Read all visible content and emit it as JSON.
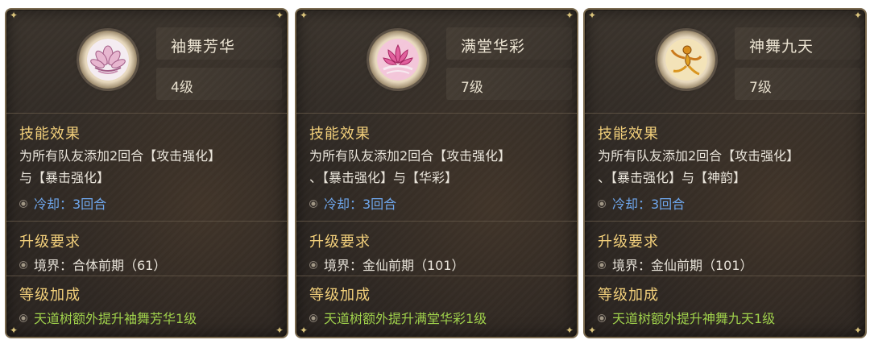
{
  "cards": [
    {
      "name": "袖舞芳华",
      "level": "4级",
      "icon": "lotus-icon",
      "effect_title": "技能效果",
      "effect_text": "为所有队友添加2回合【攻击强化】\n与【暴击强化】",
      "cooldown": "冷却：3回合",
      "req_title": "升级要求",
      "req_text": "境界：合体前期（61）",
      "bonus_title": "等级加成",
      "bonus_text": "天道树额外提升袖舞芳华1级"
    },
    {
      "name": "满堂华彩",
      "level": "7级",
      "icon": "pink-lotus-icon",
      "effect_title": "技能效果",
      "effect_text": "为所有队友添加2回合【攻击强化】\n、【暴击强化】与【华彩】",
      "cooldown": "冷却：3回合",
      "req_title": "升级要求",
      "req_text": "境界：金仙前期（101）",
      "bonus_title": "等级加成",
      "bonus_text": "天道树额外提升满堂华彩1级"
    },
    {
      "name": "神舞九天",
      "level": "7级",
      "icon": "dancer-icon",
      "effect_title": "技能效果",
      "effect_text": "为所有队友添加2回合【攻击强化】\n、【暴击强化】与【神韵】",
      "cooldown": "冷却：3回合",
      "req_title": "升级要求",
      "req_text": "境界：金仙前期（101）",
      "bonus_title": "等级加成",
      "bonus_text": "天道树额外提升神舞九天1级"
    }
  ],
  "colors": {
    "section_title": "#f2cf7a",
    "cooldown": "#6ea7ee",
    "bonus": "#9fd14a",
    "body_text": "#e9e4da"
  }
}
